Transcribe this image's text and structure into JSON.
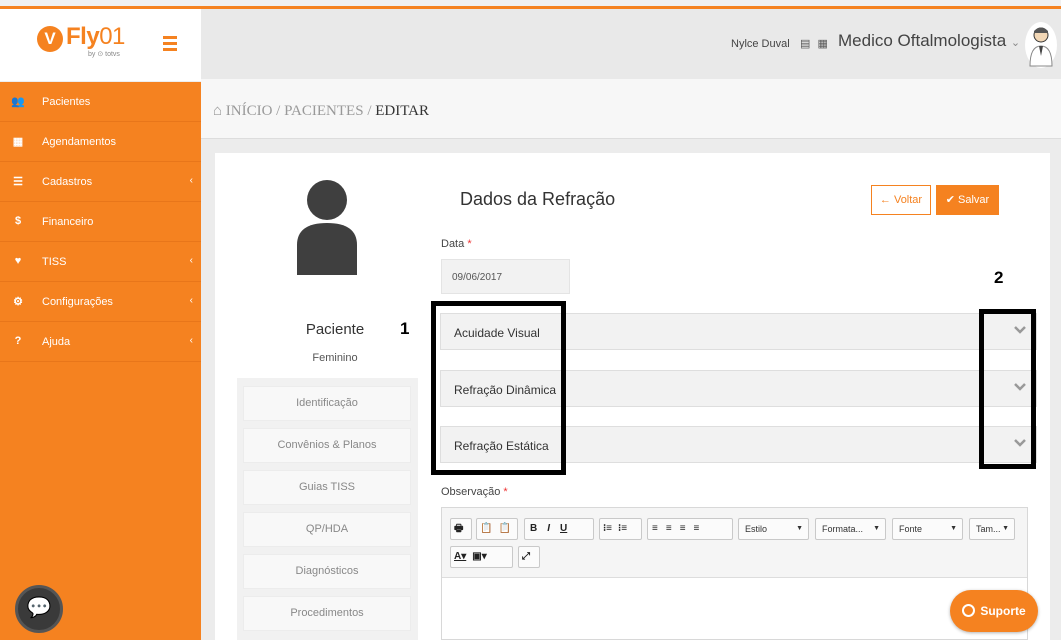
{
  "colors": {
    "accent": "#f58220",
    "sidebar": "#f58220",
    "annotation": "#000000"
  },
  "sidebar": {
    "logo_mark": "V",
    "logo_word": "Fly",
    "logo_number": "01",
    "logo_sub": "by ⊙ totvs",
    "items": [
      {
        "label": "Pacientes",
        "icon": "users-icon",
        "glyph": "👥",
        "has_chevron": false
      },
      {
        "label": "Agendamentos",
        "icon": "calendar-icon",
        "glyph": "▦",
        "has_chevron": false
      },
      {
        "label": "Cadastros",
        "icon": "list-icon",
        "glyph": "☰",
        "has_chevron": true
      },
      {
        "label": "Financeiro",
        "icon": "dollar-icon",
        "glyph": "$",
        "has_chevron": false
      },
      {
        "label": "TISS",
        "icon": "heartbeat-icon",
        "glyph": "♥",
        "has_chevron": true
      },
      {
        "label": "Configurações",
        "icon": "gear-icon",
        "glyph": "⚙",
        "has_chevron": true
      },
      {
        "label": "Ajuda",
        "icon": "question-icon",
        "glyph": "?",
        "has_chevron": true
      }
    ],
    "chevron": "‹",
    "chat_glyph": "💬"
  },
  "header": {
    "user_name": "Nylce Duval",
    "icons_glyph": "▤ ▦",
    "role": "Medico Oftalmologista",
    "role_caret": "⌄"
  },
  "breadcrumb": {
    "home_icon": "⌂",
    "home": "INÍCIO",
    "sep": " / ",
    "section": "PACIENTES",
    "current": "EDITAR"
  },
  "patient": {
    "name": "Paciente",
    "gender": "Feminino",
    "menu": [
      "Identificação",
      "Convênios & Planos",
      "Guias TISS",
      "QP/HDA",
      "Diagnósticos",
      "Procedimentos"
    ]
  },
  "form": {
    "title": "Dados da Refração",
    "back_label": "← Voltar",
    "save_label": "✔ Salvar",
    "date_label": "Data",
    "required_mark": "*",
    "date_value": "09/06/2017",
    "sections": [
      "Acuidade Visual",
      "Refração Dinâmica",
      "Refração Estática"
    ],
    "obs_label": "Observação"
  },
  "annotations": {
    "label_1": "1",
    "label_2": "2"
  },
  "editor": {
    "group1": [
      "🖶"
    ],
    "group2": [
      "📋",
      "📋"
    ],
    "group3": [
      "B",
      "I",
      "U"
    ],
    "group4": [
      "⁝≡",
      "⁝≡"
    ],
    "group5": [
      "≡",
      "≡",
      "≡",
      "≡"
    ],
    "combos": [
      "Estilo",
      "Formata...",
      "Fonte",
      "Tam..."
    ],
    "row2_a": "A▾",
    "row2_b": "▣▾",
    "row2_c": "⤢"
  },
  "support": {
    "label": "Suporte"
  }
}
